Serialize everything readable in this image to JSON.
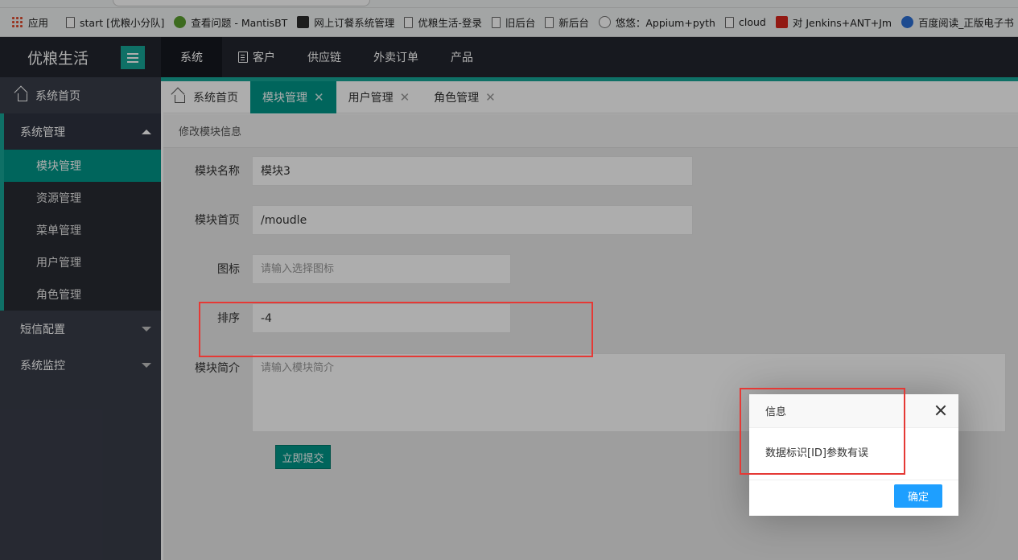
{
  "bookmarks": [
    {
      "label": "应用",
      "icon": "apps-icon"
    },
    {
      "label": "start [优粮小分队]",
      "icon": "start-icon"
    },
    {
      "label": "查看问题 - MantisBT",
      "icon": "mantis-icon"
    },
    {
      "label": "网上订餐系统管理",
      "icon": "bar-icon"
    },
    {
      "label": "优粮生活-登录",
      "icon": "page-icon"
    },
    {
      "label": "旧后台",
      "icon": "page-icon"
    },
    {
      "label": "新后台",
      "icon": "page-icon"
    },
    {
      "label": "悠悠：Appium+pyth",
      "icon": "bug-icon"
    },
    {
      "label": "cloud",
      "icon": "page-icon"
    },
    {
      "label": "对 Jenkins+ANT+Jm",
      "icon": "red-c-icon"
    },
    {
      "label": "百度阅读_正版电子书",
      "icon": "paw-icon"
    }
  ],
  "app": {
    "logo": "优粮生活",
    "topnav": [
      "系统",
      "客户",
      "供应链",
      "外卖订单",
      "产品"
    ]
  },
  "sidebar": {
    "home": "系统首页",
    "groups": [
      {
        "label": "系统管理",
        "items": [
          "模块管理",
          "资源管理",
          "菜单管理",
          "用户管理",
          "角色管理"
        ]
      },
      {
        "label": "短信配置"
      },
      {
        "label": "系统监控"
      }
    ]
  },
  "tabs": [
    {
      "label": "系统首页"
    },
    {
      "label": "模块管理"
    },
    {
      "label": "用户管理"
    },
    {
      "label": "角色管理"
    }
  ],
  "form": {
    "title": "修改模块信息",
    "name_label": "模块名称",
    "name_value": "模块3",
    "home_label": "模块首页",
    "home_value": "/moudle",
    "icon_label": "图标",
    "icon_placeholder": "请输入选择图标",
    "sort_label": "排序",
    "sort_value": "-4",
    "desc_label": "模块简介",
    "desc_placeholder": "请输入模块简介",
    "submit": "立即提交"
  },
  "dialog": {
    "title": "信息",
    "message": "数据标识[ID]参数有误",
    "ok": "确定"
  },
  "colors": {
    "teal": "#009688",
    "topbar": "#23262e",
    "sidebar": "#393d49",
    "ok_button": "#1e9fff",
    "highlight": "#e53935"
  }
}
